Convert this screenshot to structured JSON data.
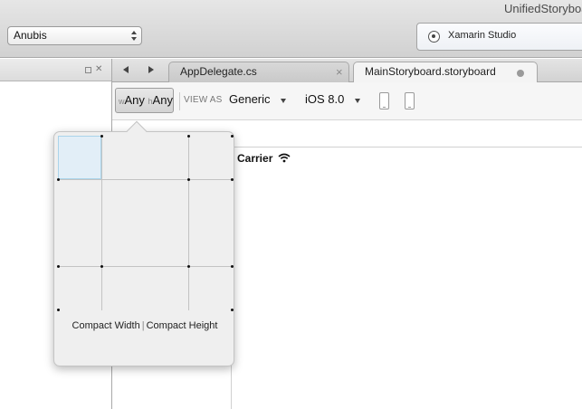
{
  "window": {
    "title": "UnifiedStoryboard"
  },
  "toolbar": {
    "configuration": "Anubis",
    "status_text": "Xamarin Studio"
  },
  "tabs": [
    {
      "label": "AppDelegate.cs",
      "close": "×"
    },
    {
      "label": "MainStoryboard.storyboard"
    }
  ],
  "designer": {
    "size_class": {
      "w_prefix": "w",
      "w_value": "Any",
      "h_prefix": "h",
      "h_value": "Any"
    },
    "view_as_label": "VIEW AS",
    "device": "Generic",
    "os_version": "iOS 8.0"
  },
  "canvas": {
    "carrier": "Carrier"
  },
  "popover": {
    "width_label": "Compact Width",
    "separator": "|",
    "height_label": "Compact Height"
  }
}
